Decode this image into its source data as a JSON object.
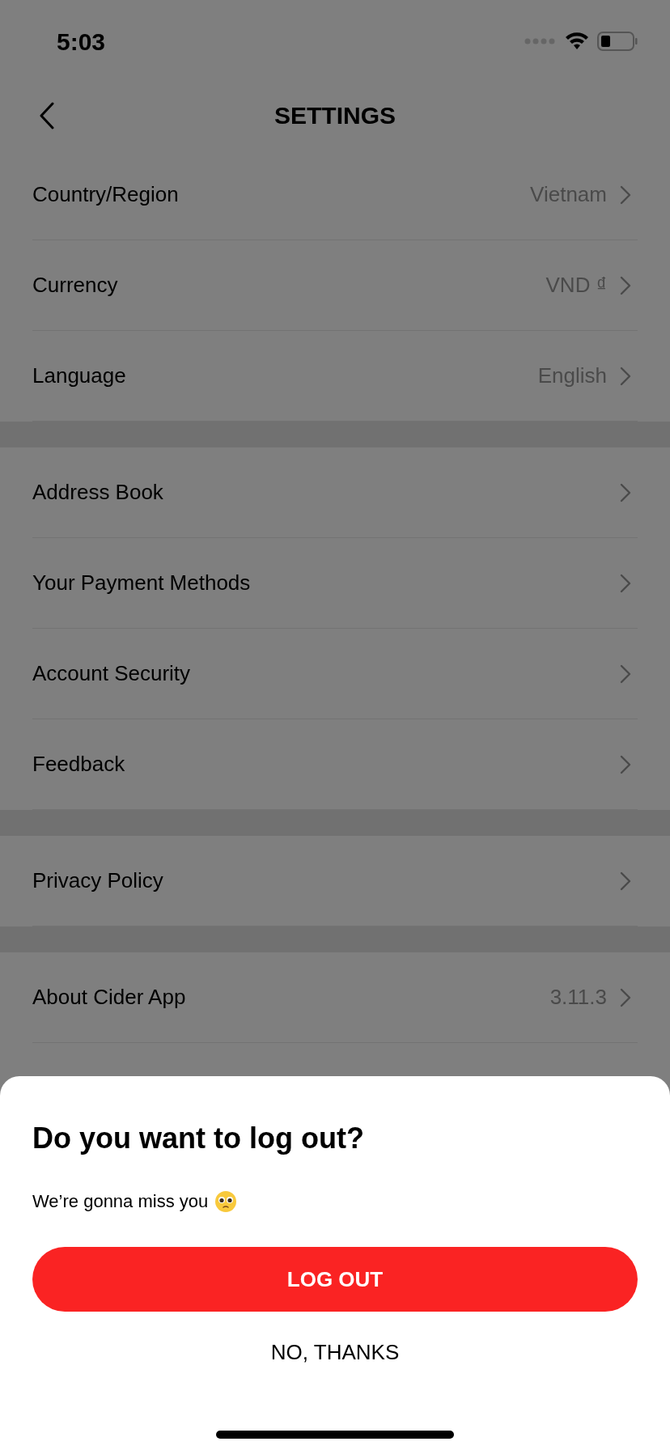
{
  "status_bar": {
    "time": "5:03"
  },
  "header": {
    "title": "SETTINGS"
  },
  "sections": [
    {
      "items": [
        {
          "label": "Country/Region",
          "value": "Vietnam"
        },
        {
          "label": "Currency",
          "value": "VND ₫"
        },
        {
          "label": "Language",
          "value": "English"
        }
      ]
    },
    {
      "items": [
        {
          "label": "Address Book"
        },
        {
          "label": "Your Payment Methods"
        },
        {
          "label": "Account Security"
        },
        {
          "label": "Feedback"
        }
      ]
    },
    {
      "items": [
        {
          "label": "Privacy Policy"
        }
      ]
    },
    {
      "items": [
        {
          "label": "About Cider App",
          "value": "3.11.3"
        }
      ]
    }
  ],
  "sheet": {
    "title": "Do you want to log out?",
    "message": "We’re gonna miss you",
    "confirm": "LOG OUT",
    "cancel": "NO, THANKS"
  }
}
